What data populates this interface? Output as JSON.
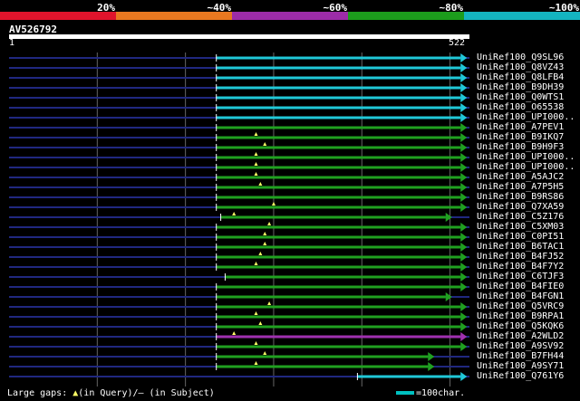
{
  "legend": {
    "items": [
      {
        "label": "20%",
        "color": "#e0142c"
      },
      {
        "label": "~40%",
        "color": "#e87820"
      },
      {
        "label": "~60%",
        "color": "#9c2ca8"
      },
      {
        "label": "~80%",
        "color": "#1c9c1c"
      },
      {
        "label": "~100%",
        "color": "#14b4c0"
      }
    ]
  },
  "query": {
    "title": "AV526792",
    "start_label": "1",
    "end_label": "522",
    "length": 522
  },
  "colors": {
    "teal": "#20c8d8",
    "green": "#20a020",
    "purple": "#a030b0",
    "navy": "#202880",
    "gap_marker": "#ffff66",
    "gridline": "#666666"
  },
  "hits": [
    {
      "label": "UniRef100_Q9SL96",
      "color": "teal",
      "query_start": 235,
      "query_end": 512,
      "arrow": "right",
      "gaps": []
    },
    {
      "label": "UniRef100_Q8VZ43",
      "color": "teal",
      "query_start": 235,
      "query_end": 512,
      "arrow": "right",
      "gaps": []
    },
    {
      "label": "UniRef100_Q8LFB4",
      "color": "teal",
      "query_start": 235,
      "query_end": 512,
      "arrow": "right",
      "gaps": []
    },
    {
      "label": "UniRef100_B9DH39",
      "color": "teal",
      "query_start": 235,
      "query_end": 512,
      "arrow": "right",
      "gaps": []
    },
    {
      "label": "UniRef100_Q0WTS1",
      "color": "teal",
      "query_start": 235,
      "query_end": 512,
      "arrow": "right",
      "gaps": []
    },
    {
      "label": "UniRef100_O65538",
      "color": "teal",
      "query_start": 235,
      "query_end": 512,
      "arrow": "right",
      "gaps": []
    },
    {
      "label": "UniRef100_UPI000..",
      "color": "teal",
      "query_start": 235,
      "query_end": 512,
      "arrow": "right",
      "gaps": []
    },
    {
      "label": "UniRef100_A7PEV1",
      "color": "green",
      "query_start": 235,
      "query_end": 512,
      "arrow": "right",
      "gaps": []
    },
    {
      "label": "UniRef100_B9IKQ7",
      "color": "green",
      "query_start": 235,
      "query_end": 512,
      "arrow": "right",
      "gaps": [
        280
      ]
    },
    {
      "label": "UniRef100_B9H9F3",
      "color": "green",
      "query_start": 235,
      "query_end": 512,
      "arrow": "right",
      "gaps": [
        290
      ]
    },
    {
      "label": "UniRef100_UPI000..",
      "color": "green",
      "query_start": 235,
      "query_end": 512,
      "arrow": "right",
      "gaps": [
        280
      ]
    },
    {
      "label": "UniRef100_UPI000..",
      "color": "green",
      "query_start": 235,
      "query_end": 512,
      "arrow": "right",
      "gaps": [
        280
      ]
    },
    {
      "label": "UniRef100_A5AJC2",
      "color": "green",
      "query_start": 235,
      "query_end": 512,
      "arrow": "right",
      "gaps": [
        280
      ]
    },
    {
      "label": "UniRef100_A7P5H5",
      "color": "green",
      "query_start": 235,
      "query_end": 512,
      "arrow": "right",
      "gaps": [
        285
      ]
    },
    {
      "label": "UniRef100_B9RS86",
      "color": "green",
      "query_start": 235,
      "query_end": 512,
      "arrow": "right",
      "gaps": []
    },
    {
      "label": "UniRef100_Q7XA59",
      "color": "green",
      "query_start": 235,
      "query_end": 512,
      "arrow": "right",
      "gaps": [
        300
      ]
    },
    {
      "label": "UniRef100_C5Z176",
      "color": "green",
      "query_start": 240,
      "query_end": 495,
      "arrow": "right",
      "gaps": [
        255
      ]
    },
    {
      "label": "UniRef100_C5XM03",
      "color": "green",
      "query_start": 235,
      "query_end": 512,
      "arrow": "right",
      "gaps": [
        295
      ]
    },
    {
      "label": "UniRef100_C0PI51",
      "color": "green",
      "query_start": 235,
      "query_end": 512,
      "arrow": "right",
      "gaps": [
        290
      ]
    },
    {
      "label": "UniRef100_B6TAC1",
      "color": "green",
      "query_start": 235,
      "query_end": 512,
      "arrow": "right",
      "gaps": [
        290
      ]
    },
    {
      "label": "UniRef100_B4FJ52",
      "color": "green",
      "query_start": 235,
      "query_end": 512,
      "arrow": "right",
      "gaps": [
        285
      ]
    },
    {
      "label": "UniRef100_B4F7Y2",
      "color": "green",
      "query_start": 235,
      "query_end": 512,
      "arrow": "right",
      "gaps": [
        280
      ]
    },
    {
      "label": "UniRef100_C6TJF3",
      "color": "green",
      "query_start": 245,
      "query_end": 512,
      "arrow": "right",
      "gaps": []
    },
    {
      "label": "UniRef100_B4FIE0",
      "color": "green",
      "query_start": 235,
      "query_end": 512,
      "arrow": "right",
      "gaps": []
    },
    {
      "label": "UniRef100_B4FGN1",
      "color": "green",
      "query_start": 235,
      "query_end": 495,
      "arrow": "right",
      "gaps": []
    },
    {
      "label": "UniRef100_Q5VRC9",
      "color": "green",
      "query_start": 235,
      "query_end": 512,
      "arrow": "right",
      "gaps": [
        295
      ]
    },
    {
      "label": "UniRef100_B9RPA1",
      "color": "green",
      "query_start": 235,
      "query_end": 512,
      "arrow": "right",
      "gaps": [
        280
      ]
    },
    {
      "label": "UniRef100_Q5KQK6",
      "color": "green",
      "query_start": 235,
      "query_end": 512,
      "arrow": "right",
      "gaps": [
        285
      ]
    },
    {
      "label": "UniRef100_A2WLD2",
      "color": "purple",
      "query_start": 235,
      "query_end": 512,
      "arrow": "right",
      "gaps": [
        255
      ]
    },
    {
      "label": "UniRef100_A9SV92",
      "color": "green",
      "query_start": 235,
      "query_end": 512,
      "arrow": "right",
      "gaps": [
        280
      ]
    },
    {
      "label": "UniRef100_B7FH44",
      "color": "green",
      "query_start": 235,
      "query_end": 475,
      "arrow": "right",
      "gaps": [
        290
      ]
    },
    {
      "label": "UniRef100_A9SY71",
      "color": "green",
      "query_start": 235,
      "query_end": 475,
      "arrow": "right",
      "gaps": [
        280
      ]
    },
    {
      "label": "UniRef100_Q761Y6",
      "color": "teal",
      "query_start": 395,
      "query_end": 512,
      "arrow": "right",
      "gaps": []
    }
  ],
  "footer": {
    "large_gaps_prefix": "Large gaps: ",
    "large_gaps_query_marker": "▲",
    "large_gaps_text": "(in Query)/– (in Subject)",
    "scale_text": "=100char."
  }
}
